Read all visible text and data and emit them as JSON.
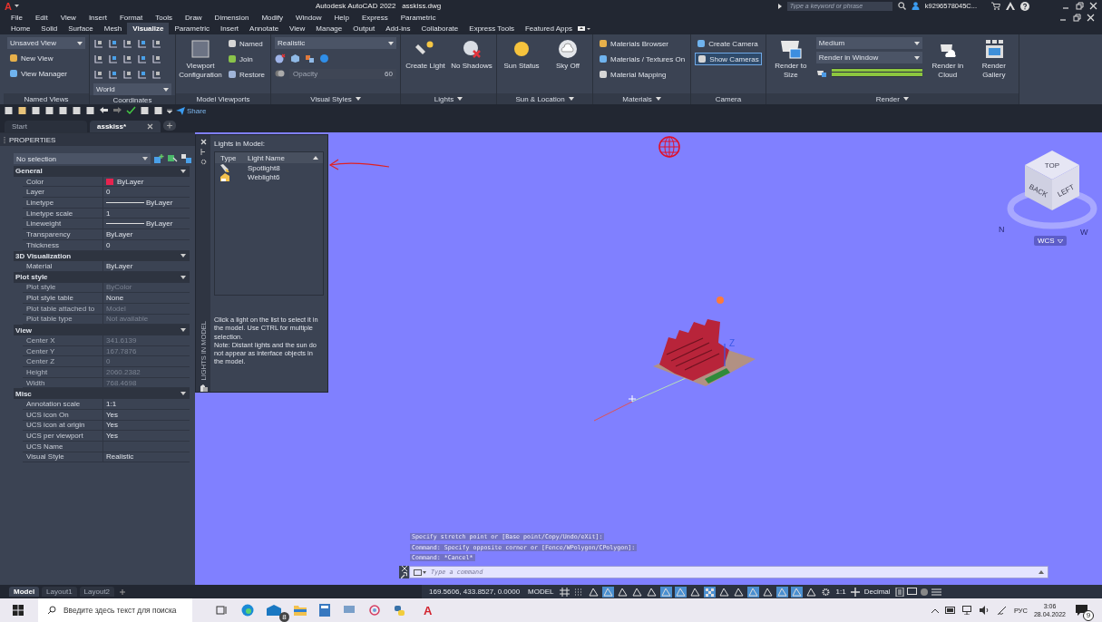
{
  "title_bar": {
    "logo": "A",
    "app_title": "Autodesk AutoCAD 2022",
    "file_name": "asskiss.dwg",
    "search_placeholder": "Type a keyword or phrase",
    "user": "k9296578045C..."
  },
  "menu_bar": [
    "File",
    "Edit",
    "View",
    "Insert",
    "Format",
    "Tools",
    "Draw",
    "Dimension",
    "Modify",
    "Window",
    "Help",
    "Express",
    "Parametric"
  ],
  "ribbon_tabs": [
    {
      "label": "Home",
      "selected": false
    },
    {
      "label": "Solid",
      "selected": false
    },
    {
      "label": "Surface",
      "selected": false
    },
    {
      "label": "Mesh",
      "selected": false
    },
    {
      "label": "Visualize",
      "selected": true
    },
    {
      "label": "Parametric",
      "selected": false
    },
    {
      "label": "Insert",
      "selected": false
    },
    {
      "label": "Annotate",
      "selected": false
    },
    {
      "label": "View",
      "selected": false
    },
    {
      "label": "Manage",
      "selected": false
    },
    {
      "label": "Output",
      "selected": false
    },
    {
      "label": "Add-ins",
      "selected": false
    },
    {
      "label": "Collaborate",
      "selected": false
    },
    {
      "label": "Express Tools",
      "selected": false
    },
    {
      "label": "Featured Apps",
      "selected": false
    }
  ],
  "ribbon_panels": [
    {
      "title": "Named Views",
      "has_menu": false,
      "items": [
        {
          "kind": "dropdown",
          "label": "Unsaved View"
        },
        {
          "kind": "small",
          "label": "New View"
        },
        {
          "kind": "small",
          "label": "View Manager"
        }
      ]
    },
    {
      "title": "Coordinates",
      "has_menu": false,
      "items": [
        {
          "kind": "icon_grid"
        },
        {
          "kind": "dropdown",
          "label": "World"
        }
      ]
    },
    {
      "title": "Model Viewports",
      "has_menu": false,
      "items": [
        {
          "kind": "large",
          "label": "Viewport Configuration"
        },
        {
          "kind": "small",
          "label": "Named"
        },
        {
          "kind": "small",
          "label": "Join"
        },
        {
          "kind": "small",
          "label": "Restore"
        }
      ]
    },
    {
      "title": "Visual Styles",
      "has_menu": true,
      "items": [
        {
          "kind": "dropdown",
          "label": "Realistic"
        },
        {
          "kind": "icon_row"
        },
        {
          "kind": "slider",
          "placeholder": "Opacity",
          "value": "60",
          "disabled": true
        }
      ]
    },
    {
      "title": "Lights",
      "has_menu": true,
      "items": [
        {
          "kind": "large",
          "label": "Create Light"
        },
        {
          "kind": "large",
          "label": "No Shadows"
        }
      ]
    },
    {
      "title": "Sun & Location",
      "has_menu": true,
      "items": [
        {
          "kind": "large",
          "label": "Sun Status"
        },
        {
          "kind": "large",
          "label": "Sky Off"
        }
      ]
    },
    {
      "title": "Materials",
      "has_menu": true,
      "items": [
        {
          "kind": "small",
          "label": "Materials Browser"
        },
        {
          "kind": "small",
          "label": "Materials / Textures On"
        },
        {
          "kind": "small",
          "label": "Material Mapping"
        }
      ]
    },
    {
      "title": "Camera",
      "has_menu": false,
      "items": [
        {
          "kind": "small",
          "label": "Create Camera",
          "selected": false
        },
        {
          "kind": "small",
          "label": "Show  Cameras",
          "selected": true
        }
      ]
    },
    {
      "title": "Render",
      "has_menu": true,
      "items": [
        {
          "kind": "large",
          "label": "Render to Size"
        },
        {
          "kind": "dropdown",
          "label": "Medium"
        },
        {
          "kind": "dropdown",
          "label": "Render in Window"
        },
        {
          "kind": "progress",
          "level": 1
        },
        {
          "kind": "large",
          "label": "Render in Cloud"
        },
        {
          "kind": "large",
          "label": "Render Gallery"
        }
      ]
    }
  ],
  "quick_access": {
    "share": "Share"
  },
  "doc_tabs": [
    {
      "label": "Start",
      "selected": false
    },
    {
      "label": "asskiss*",
      "selected": true
    }
  ],
  "properties": {
    "title": "PROPERTIES",
    "selection": "No selection",
    "sections": [
      {
        "title": "General",
        "expanded": true,
        "rows": [
          {
            "name": "Color",
            "value": "ByLayer",
            "kind": "color",
            "color": "#e8234f",
            "dimmed": false
          },
          {
            "name": "Layer",
            "value": "0",
            "kind": "text",
            "dimmed": false
          },
          {
            "name": "Linetype",
            "value": "ByLayer",
            "kind": "line",
            "dimmed": false
          },
          {
            "name": "Linetype scale",
            "value": "1",
            "kind": "text",
            "dimmed": false
          },
          {
            "name": "Lineweight",
            "value": "ByLayer",
            "kind": "line",
            "dimmed": false
          },
          {
            "name": "Transparency",
            "value": "ByLayer",
            "kind": "text",
            "dimmed": false
          },
          {
            "name": "Thickness",
            "value": "0",
            "kind": "text",
            "dimmed": false
          }
        ]
      },
      {
        "title": "3D Visualization",
        "expanded": true,
        "rows": [
          {
            "name": "Material",
            "value": "ByLayer",
            "kind": "text",
            "dimmed": false
          }
        ]
      },
      {
        "title": "Plot style",
        "expanded": true,
        "rows": [
          {
            "name": "Plot style",
            "value": "ByColor",
            "kind": "text",
            "dimmed": true
          },
          {
            "name": "Plot style table",
            "value": "None",
            "kind": "text",
            "dimmed": false
          },
          {
            "name": "Plot table attached to",
            "value": "Model",
            "kind": "text",
            "dimmed": true
          },
          {
            "name": "Plot table type",
            "value": "Not available",
            "kind": "text",
            "dimmed": true
          }
        ]
      },
      {
        "title": "View",
        "expanded": true,
        "rows": [
          {
            "name": "Center X",
            "value": "341.6139",
            "kind": "text",
            "dimmed": true
          },
          {
            "name": "Center Y",
            "value": "167.7876",
            "kind": "text",
            "dimmed": true
          },
          {
            "name": "Center Z",
            "value": "0",
            "kind": "text",
            "dimmed": true
          },
          {
            "name": "Height",
            "value": "2060.2382",
            "kind": "text",
            "dimmed": true
          },
          {
            "name": "Width",
            "value": "768.4698",
            "kind": "text",
            "dimmed": true
          }
        ]
      },
      {
        "title": "Misc",
        "expanded": true,
        "rows": [
          {
            "name": "Annotation scale",
            "value": "1:1",
            "kind": "text",
            "dimmed": false
          },
          {
            "name": "UCS icon On",
            "value": "Yes",
            "kind": "text",
            "dimmed": false
          },
          {
            "name": "UCS icon at origin",
            "value": "Yes",
            "kind": "text",
            "dimmed": false
          },
          {
            "name": "UCS per viewport",
            "value": "Yes",
            "kind": "text",
            "dimmed": false
          },
          {
            "name": "UCS Name",
            "value": null,
            "kind": "text",
            "dimmed": false
          },
          {
            "name": "Visual Style",
            "value": "Realistic",
            "kind": "text",
            "dimmed": false
          }
        ]
      }
    ]
  },
  "lights_palette": {
    "side_label": "LIGHTS IN MODEL",
    "title": "Lights in Model:",
    "columns": [
      "Type",
      "Light Name"
    ],
    "lights": [
      {
        "name": "Spotlight8",
        "kind": "spotlight"
      },
      {
        "name": "Weblight6",
        "kind": "weblight"
      }
    ],
    "help": "Click a light on the list to select it in the model. Use CTRL for multiple selection.\nNote: Distant lights and the sun do not appear as interface objects in the model."
  },
  "viewport": {
    "axis_label": "Z",
    "viewcube": {
      "faces": [
        "TOP",
        "BACK",
        "LEFT"
      ],
      "compass": [
        "N",
        "W"
      ],
      "ucs_menu": "WCS"
    }
  },
  "command_line": {
    "history": [
      "Specify stretch point or [Base point/Copy/Undo/eXit]:",
      "Command: Specify opposite corner or [Fence/WPolygon/CPolygon]:",
      "Command: *Cancel*"
    ],
    "placeholder": "Type a command"
  },
  "layout_tabs": [
    {
      "label": "Model",
      "selected": true
    },
    {
      "label": "Layout1",
      "selected": false
    },
    {
      "label": "Layout2",
      "selected": false
    }
  ],
  "status_bar": {
    "coordinates": "169.5606, 433.8527, 0.0000",
    "space": "MODEL",
    "toggles": [
      {
        "on": false
      },
      {
        "on": false
      },
      {
        "on": false
      },
      {
        "on": true
      },
      {
        "on": false
      },
      {
        "on": false
      },
      {
        "on": false
      },
      {
        "on": true
      },
      {
        "on": true
      },
      {
        "on": false
      },
      {
        "on": true
      },
      {
        "on": false
      },
      {
        "on": false
      },
      {
        "on": true
      },
      {
        "on": false
      },
      {
        "on": true
      },
      {
        "on": true
      },
      {
        "on": false
      },
      {
        "on": false
      }
    ],
    "scale": "1:1",
    "units": "Decimal"
  },
  "taskbar": {
    "search_placeholder": "Введите здесь текст для поиска",
    "mail_badge": "8",
    "app_letter": "A",
    "language": "РУС",
    "time": "3:06",
    "date": "28.04.2022",
    "notifications": "9"
  }
}
